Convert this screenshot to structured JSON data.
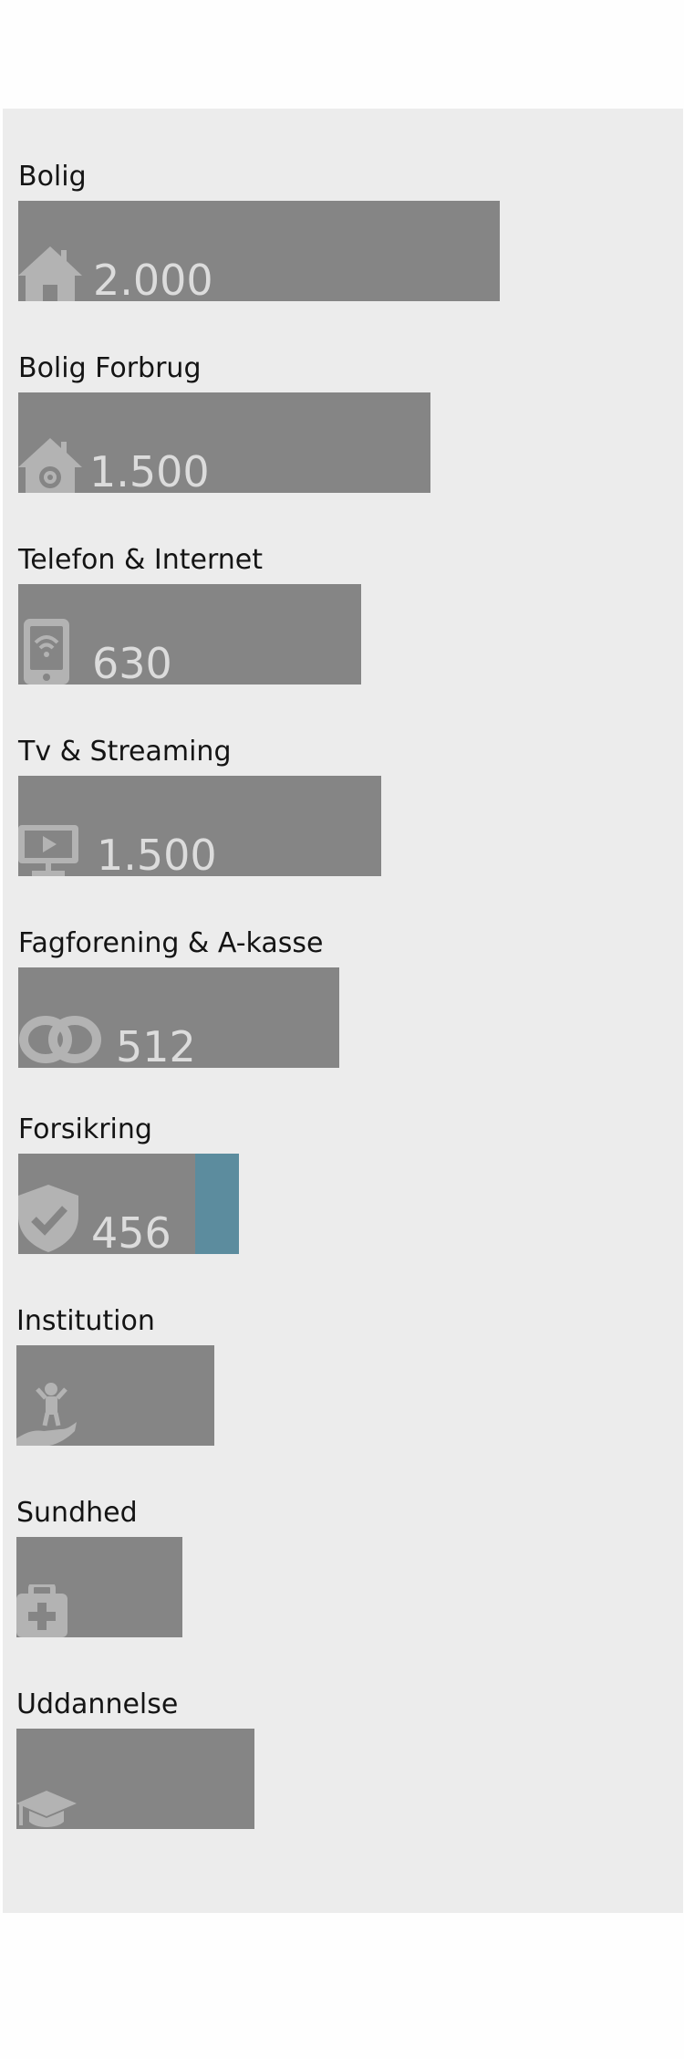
{
  "colors": {
    "panel_bg": "#ececec",
    "bar_bg": "#858585",
    "icon_color": "#b3b3b3",
    "value_text": "#dcdcdc",
    "accent": "#5c8c9e"
  },
  "categories": [
    {
      "label": "Bolig",
      "value": "2.000",
      "icon": "house-icon"
    },
    {
      "label": "Bolig Forbrug",
      "value": "1.500",
      "icon": "house-gear-icon"
    },
    {
      "label": "Telefon & Internet",
      "value": "630",
      "icon": "mobile-wifi-icon"
    },
    {
      "label": "Tv & Streaming",
      "value": "1.500",
      "icon": "monitor-play-icon"
    },
    {
      "label": "Fagforening & A-kasse",
      "value": "512",
      "icon": "linked-rings-icon"
    },
    {
      "label": "Forsikring",
      "value": "456",
      "icon": "shield-check-icon"
    },
    {
      "label": "Institution",
      "value": "",
      "icon": "child-hand-icon"
    },
    {
      "label": "Sundhed",
      "value": "",
      "icon": "medical-kit-icon"
    },
    {
      "label": "Uddannelse",
      "value": "",
      "icon": "graduation-cap-icon"
    }
  ]
}
